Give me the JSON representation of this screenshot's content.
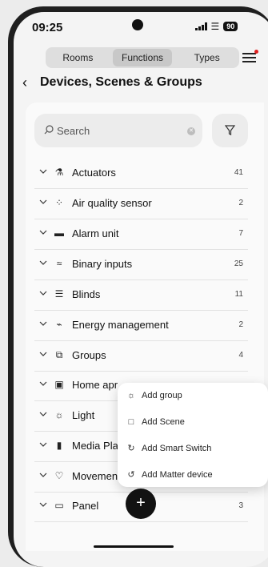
{
  "status": {
    "time": "09:25",
    "battery": "90"
  },
  "tabs": [
    {
      "label": "Rooms",
      "active": false
    },
    {
      "label": "Functions",
      "active": true
    },
    {
      "label": "Types",
      "active": false
    }
  ],
  "header": {
    "title": "Devices, Scenes & Groups"
  },
  "search": {
    "placeholder": "Search"
  },
  "rows": [
    {
      "label": "Actuators",
      "count": "41",
      "icon": "actuator-icon"
    },
    {
      "label": "Air quality sensor",
      "count": "2",
      "icon": "air-quality-icon"
    },
    {
      "label": "Alarm unit",
      "count": "7",
      "icon": "alarm-icon"
    },
    {
      "label": "Binary inputs",
      "count": "25",
      "icon": "binary-input-icon"
    },
    {
      "label": "Blinds",
      "count": "11",
      "icon": "blinds-icon"
    },
    {
      "label": "Energy management",
      "count": "2",
      "icon": "energy-icon"
    },
    {
      "label": "Groups",
      "count": "4",
      "icon": "groups-icon"
    },
    {
      "label": "Home apr",
      "count": "",
      "icon": "home-appliance-icon"
    },
    {
      "label": "Light",
      "count": "",
      "icon": "light-icon"
    },
    {
      "label": "Media Pla",
      "count": "",
      "icon": "media-player-icon"
    },
    {
      "label": "Movemen",
      "count": "",
      "icon": "movement-icon"
    },
    {
      "label": "Panel",
      "count": "3",
      "icon": "panel-icon"
    }
  ],
  "popup": {
    "items": [
      {
        "label": "Add group",
        "icon": "light-bulb-icon"
      },
      {
        "label": "Add Scene",
        "icon": "scene-icon"
      },
      {
        "label": "Add Smart Switch",
        "icon": "smart-switch-icon"
      },
      {
        "label": "Add Matter device",
        "icon": "matter-icon"
      }
    ]
  },
  "fab": {
    "symbol": "+"
  }
}
